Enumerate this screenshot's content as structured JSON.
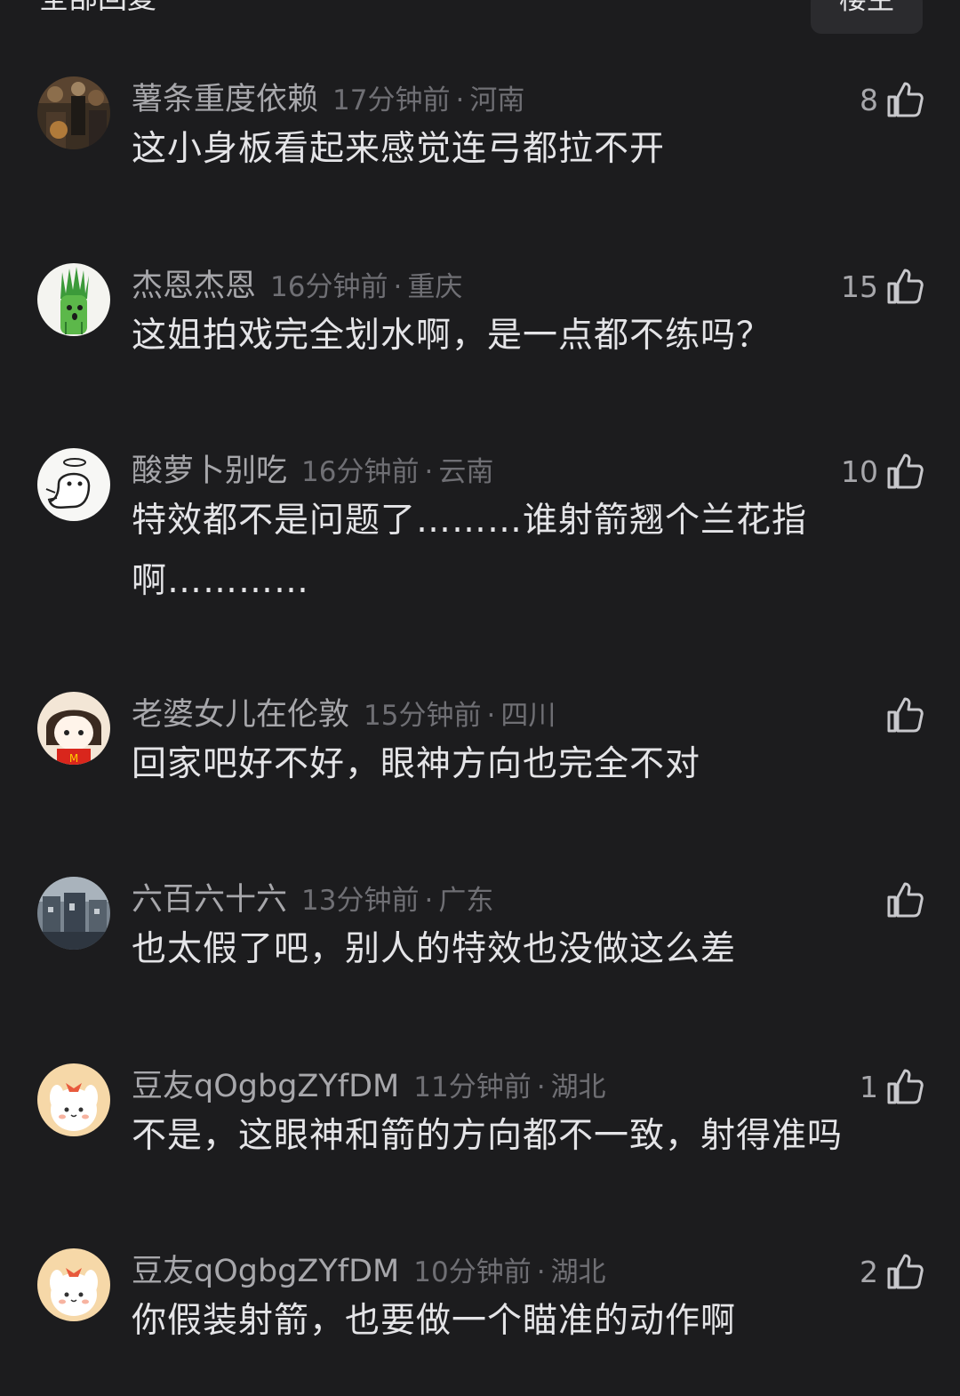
{
  "header": {
    "section_title": "全部回复",
    "op_label": "楼主"
  },
  "comments": [
    {
      "user": "薯条重度依赖",
      "time": "17分钟前",
      "region": "河南",
      "likes": "8",
      "text": "这小身板看起来感觉连弓都拉不开",
      "avatar": "crowd-photo-avatar"
    },
    {
      "user": "杰恩杰恩",
      "time": "16分钟前",
      "region": "重庆",
      "likes": "15",
      "text": "这姐拍戏完全划水啊，是一点都不练吗？",
      "avatar": "green-onion-avatar"
    },
    {
      "user": "酸萝卜别吃",
      "time": "16分钟前",
      "region": "云南",
      "likes": "10",
      "text": "特效都不是问题了………谁射箭翘个兰花指啊…………",
      "avatar": "angel-ghost-avatar"
    },
    {
      "user": "老婆女儿在伦敦",
      "time": "15分钟前",
      "region": "四川",
      "likes": "",
      "text": "回家吧好不好，眼神方向也完全不对",
      "avatar": "cartoon-girl-avatar"
    },
    {
      "user": "六百六十六",
      "time": "13分钟前",
      "region": "广东",
      "likes": "",
      "text": "也太假了吧，别人的特效也没做这么差",
      "avatar": "street-photo-avatar"
    },
    {
      "user": "豆友qOgbgZYfDM",
      "time": "11分钟前",
      "region": "湖北",
      "likes": "1",
      "text": "不是，这眼神和箭的方向都不一致，射得准吗",
      "avatar": "bunny-avatar"
    },
    {
      "user": "豆友qOgbgZYfDM",
      "time": "10分钟前",
      "region": "湖北",
      "likes": "2",
      "text": "你假装射箭，也要做一个瞄准的动作啊",
      "avatar": "bunny-avatar"
    }
  ],
  "separator": "·",
  "icons": {
    "like": "thumbs-up-icon"
  },
  "colors": {
    "background": "#1c1c1e",
    "text": "#e4e4e7",
    "meta": "#6f6f74",
    "username": "#a7a7ab"
  }
}
